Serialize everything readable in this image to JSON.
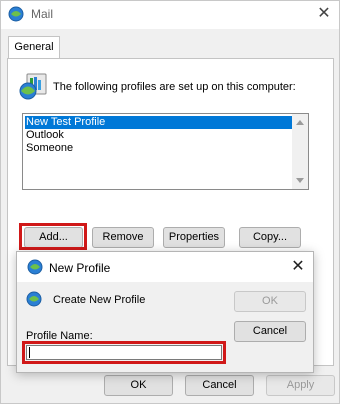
{
  "window": {
    "title": "Mail",
    "close_glyph": "✕"
  },
  "tabs": [
    {
      "label": "General"
    }
  ],
  "profiles": {
    "description": "The following profiles are set up on this computer:",
    "list": [
      "New Test Profile",
      "Outlook",
      "Someone"
    ],
    "selected": "New Test Profile"
  },
  "profile_buttons": {
    "add": "Add...",
    "remove": "Remove",
    "properties": "Properties",
    "copy": "Copy..."
  },
  "footer_buttons": {
    "ok": "OK",
    "cancel": "Cancel",
    "apply": "Apply"
  },
  "new_profile_dialog": {
    "title": "New Profile",
    "close_glyph": "✕",
    "heading": "Create New Profile",
    "ok": "OK",
    "cancel": "Cancel",
    "name_label": "Profile Name:",
    "name_value": ""
  },
  "colors": {
    "selection": "#0078d7",
    "highlight_red": "#d01818",
    "window_bg": "#f0f0f0"
  },
  "icons": {
    "app": "mail-app-icon",
    "profiles": "mail-profiles-icon",
    "dialog": "new-profile-globe-icon",
    "create": "create-profile-globe-icon"
  }
}
